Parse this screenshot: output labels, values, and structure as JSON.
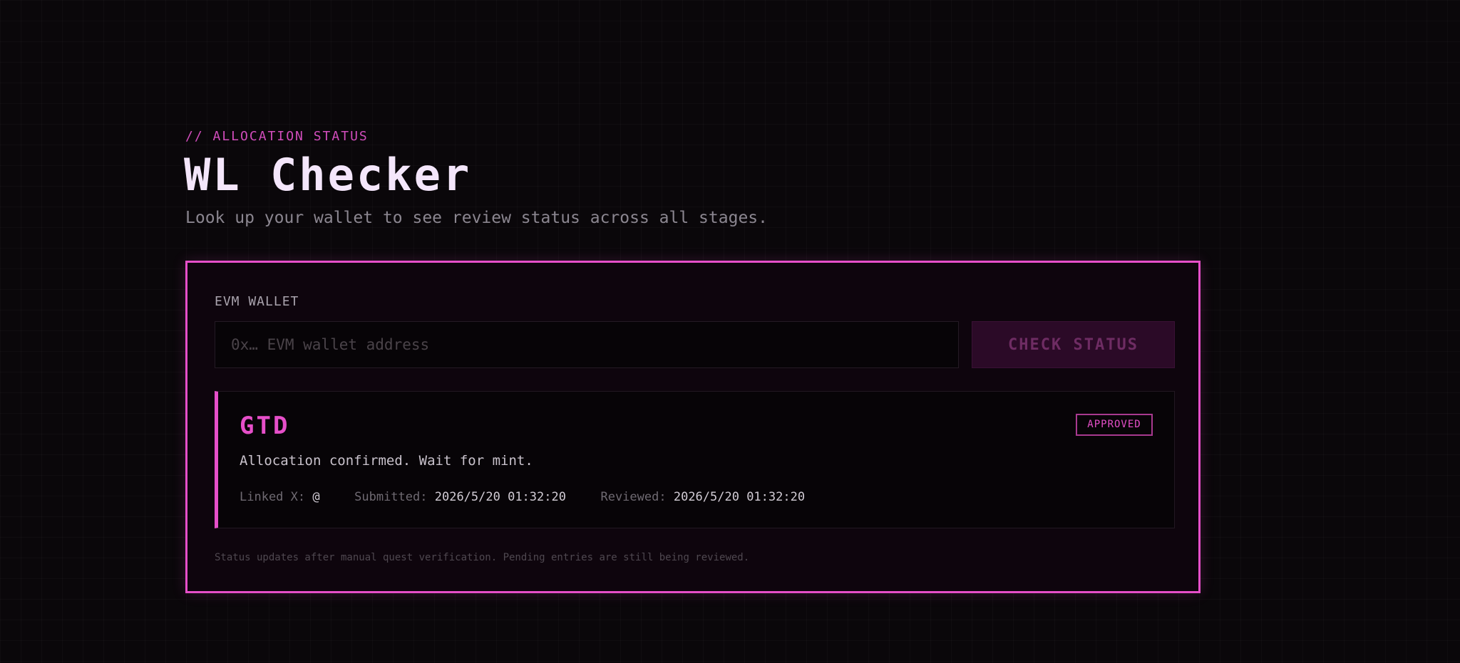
{
  "header": {
    "eyebrow": "// ALLOCATION STATUS",
    "title": "WL Checker",
    "subtitle": "Look up your wallet to see review status across all stages."
  },
  "form": {
    "label": "EVM WALLET",
    "input_placeholder": "0x… EVM wallet address",
    "input_value": "",
    "button_label": "CHECK STATUS"
  },
  "result": {
    "tier": "GTD",
    "badge": "APPROVED",
    "message": "Allocation confirmed. Wait for mint.",
    "linked_x_label": "Linked X:",
    "linked_x_value": "@",
    "submitted_label": "Submitted:",
    "submitted_value": "2026/5/20 01:32:20",
    "reviewed_label": "Reviewed:",
    "reviewed_value": "2026/5/20 01:32:20"
  },
  "footnote": "Status updates after manual quest verification. Pending entries are still being reviewed.",
  "colors": {
    "accent": "#e64fc9",
    "background": "#0a070a",
    "title": "#f4e6fb"
  }
}
